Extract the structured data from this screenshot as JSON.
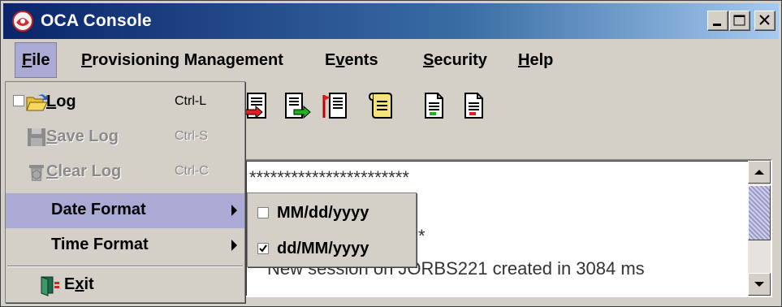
{
  "window": {
    "title": "OCA Console"
  },
  "menubar": {
    "items": [
      {
        "label": "File",
        "mnemonic": "F",
        "rest": "ile"
      },
      {
        "label": "Provisioning Management",
        "mnemonic": "P",
        "rest": "rovisioning Management"
      },
      {
        "label": "Events",
        "pre": "E",
        "mnemonic": "v",
        "rest": "ents"
      },
      {
        "label": "Security",
        "mnemonic": "S",
        "rest": "ecurity"
      },
      {
        "label": "Help",
        "mnemonic": "H",
        "rest": "elp"
      }
    ]
  },
  "file_menu": {
    "items": [
      {
        "label": "Log",
        "mnemonic": "L",
        "rest": "og",
        "shortcut": "Ctrl-L",
        "checked": false,
        "enabled": true,
        "icon": "open-folder-icon"
      },
      {
        "label": "Save Log",
        "mnemonic": "S",
        "rest": "ave Log",
        "shortcut": "Ctrl-S",
        "enabled": false,
        "icon": "floppy-disk-icon"
      },
      {
        "label": "Clear Log",
        "mnemonic": "C",
        "rest": "lear Log",
        "shortcut": "Ctrl-C",
        "enabled": false,
        "icon": "trash-can-icon"
      },
      {
        "label": "Date Format",
        "has_submenu": true
      },
      {
        "label": "Time Format",
        "has_submenu": true
      },
      {
        "label": "Exit",
        "pre": "E",
        "mnemonic": "x",
        "rest": "it",
        "icon": "exit-door-icon"
      }
    ]
  },
  "date_format_submenu": {
    "items": [
      {
        "label": "MM/dd/yyyy",
        "checked": false
      },
      {
        "label": "dd/MM/yyyy",
        "checked": true
      }
    ]
  },
  "console": {
    "lines": [
      "***********************",
      "*",
      "New session on JORBS221 created in 3084 ms"
    ]
  },
  "toolbar": {
    "buttons": [
      {
        "icon": "document-red-arrow-icon"
      },
      {
        "icon": "document-green-arrow-icon"
      },
      {
        "icon": "document-red-flag-icon"
      },
      {
        "icon": "scroll-icon"
      },
      {
        "icon": "document-green-icon"
      },
      {
        "icon": "document-red-icon"
      }
    ]
  },
  "colors": {
    "title_gradient_start": "#0a246a",
    "title_gradient_end": "#a6caf0",
    "menu_highlight": "#aaaad4",
    "panel": "#d4d0c8"
  }
}
